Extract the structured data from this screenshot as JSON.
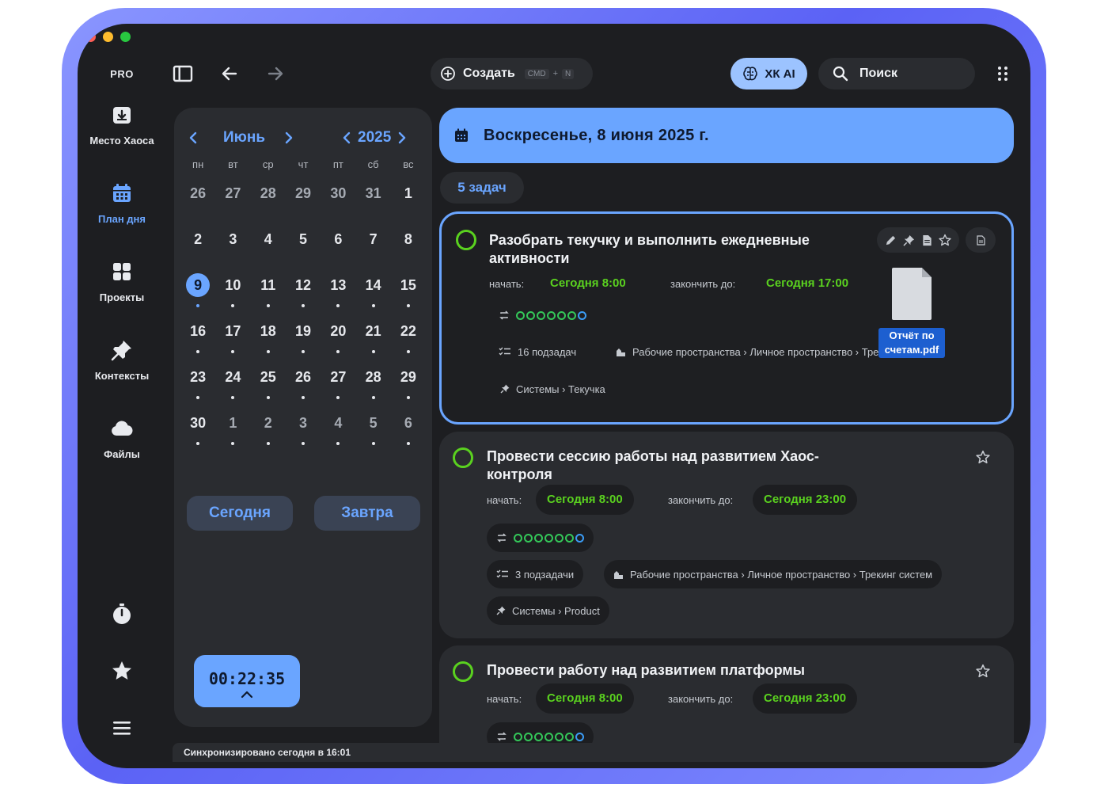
{
  "sidebar": {
    "plan_label": "PRO",
    "items": [
      {
        "label": "Место Хаоса",
        "icon": "inbox-tray-icon"
      },
      {
        "label": "План дня",
        "icon": "calendar-icon",
        "active": true
      },
      {
        "label": "Проекты",
        "icon": "grid-icon"
      },
      {
        "label": "Контексты",
        "icon": "pushpin-icon"
      },
      {
        "label": "Файлы",
        "icon": "cloud-icon"
      }
    ],
    "bottom_icons": [
      "stopwatch-icon",
      "star-icon",
      "menu-icon"
    ]
  },
  "toolbar": {
    "create_label": "Создать",
    "shortcut_key1": "CMD",
    "shortcut_plus": "+",
    "shortcut_key2": "N",
    "ai_label": "ХК AI",
    "search_placeholder": "Поиск"
  },
  "calendar": {
    "month": "Июнь",
    "year": "2025",
    "weekdays": [
      "пн",
      "вт",
      "ср",
      "чт",
      "пт",
      "сб",
      "вс"
    ],
    "weeks": [
      [
        "26",
        "27",
        "28",
        "29",
        "30",
        "31",
        "1"
      ],
      [
        "2",
        "3",
        "4",
        "5",
        "6",
        "7",
        "8"
      ],
      [
        "9",
        "10",
        "11",
        "12",
        "13",
        "14",
        "15"
      ],
      [
        "16",
        "17",
        "18",
        "19",
        "20",
        "21",
        "22"
      ],
      [
        "23",
        "24",
        "25",
        "26",
        "27",
        "28",
        "29"
      ],
      [
        "30",
        "1",
        "2",
        "3",
        "4",
        "5",
        "6"
      ]
    ],
    "selected_day": "9",
    "today_button": "Сегодня",
    "tomorrow_button": "Завтра"
  },
  "timer": {
    "value": "00:22:35"
  },
  "main": {
    "date_title": "Воскресенье, 8 июня 2025 г.",
    "task_count": "5 задач",
    "start_label": "начать:",
    "end_label": "закончить до:",
    "tasks": [
      {
        "title_line1": "Разобрать текучку и выполнить ежедневные",
        "title_line2": "активности",
        "start": "Сегодня 8:00",
        "end": "Сегодня 17:00",
        "subtasks": "16 подзадач",
        "workspace": "Рабочие пространства › Личное пространство › Трекинг систем",
        "context": "Системы › Текучка",
        "attachment": "Отчёт по счетам.pdf"
      },
      {
        "title_line1": "Провести сессию работы над развитием Хаос-",
        "title_line2": "контроля",
        "start": "Сегодня 8:00",
        "end": "Сегодня 23:00",
        "subtasks": "3 подзадачи",
        "workspace": "Рабочие пространства › Личное пространство › Трекинг систем",
        "context": "Системы › Product"
      },
      {
        "title_line1": "Провести работу над развитием платформы",
        "start": "Сегодня 8:00",
        "end": "Сегодня 23:00"
      }
    ]
  },
  "status_bar": {
    "text": "Синхронизировано сегодня в 16:01"
  },
  "colors": {
    "accent": "#6aa5ff",
    "success": "#5ad11f",
    "bezel": "#6a72f8",
    "bg": "#1d1e21",
    "panel": "#2a2c30"
  }
}
